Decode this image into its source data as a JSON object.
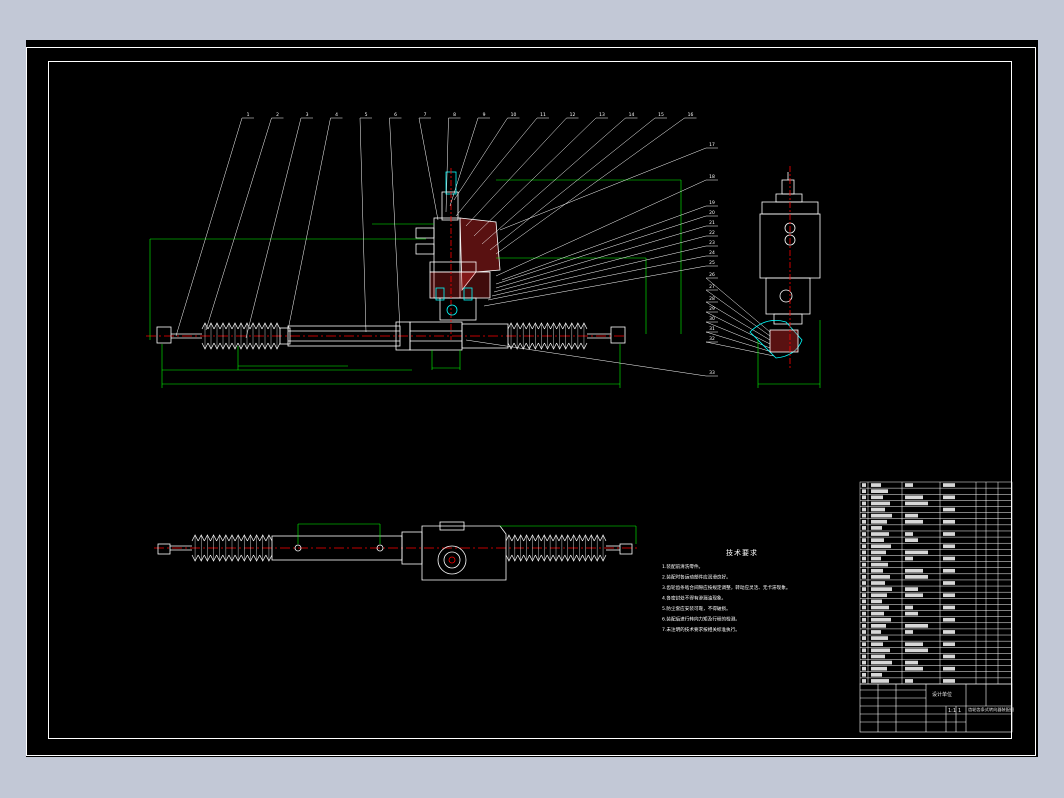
{
  "drawing": {
    "callouts_top": [
      "1",
      "2",
      "3",
      "4",
      "5",
      "6",
      "7",
      "8",
      "9",
      "10",
      "11",
      "12",
      "13",
      "14",
      "15",
      "16"
    ],
    "callouts_right": [
      "17",
      "18",
      "19",
      "20",
      "21",
      "22",
      "23",
      "24",
      "25",
      "26",
      "27",
      "28",
      "29",
      "30",
      "31",
      "32",
      "33"
    ],
    "technical_requirements": {
      "title": "技术要求",
      "notes": [
        "1.装配前清洗零件。",
        "2.装配时各运动部件应润滑良好。",
        "3.齿轮齿条啮合间隙应按规定调整，转动应灵活、无卡滞现象。",
        "4.各密封处不得有渗漏油现象。",
        "5.防尘套应安装可靠，不得破损。",
        "6.装配后进行转向力矩及行程的检测。",
        "7.未注明的技术要求按相关标准执行。"
      ]
    },
    "title_block": {
      "drawing_name": "齿轮齿条式转向器装配图",
      "school": "设计单位",
      "scale": "1:1",
      "sheet": "1"
    }
  },
  "colors": {
    "background": "#000000",
    "outline": "#ffffff",
    "dimension": "#00ff00",
    "center_line": "#ff0000",
    "seal": "#00ffff",
    "outer_frame": "#c2c8d6"
  }
}
